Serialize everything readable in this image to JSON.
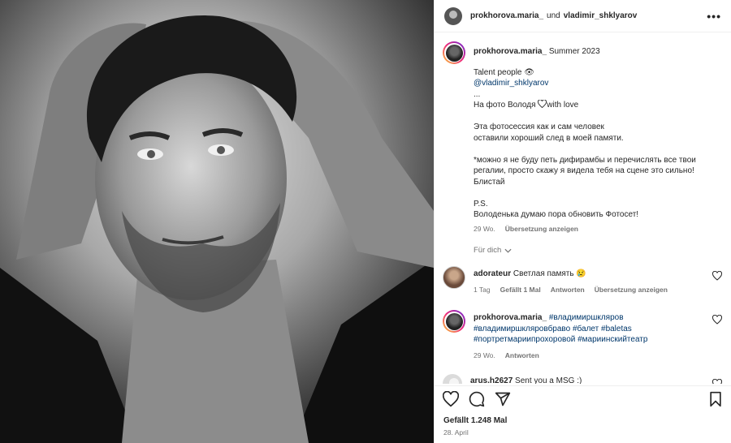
{
  "header": {
    "user1": "prokhorova.maria_",
    "und": "und",
    "user2": "vladimir_shklyarov",
    "more_icon": "more-horizontal-icon"
  },
  "caption": {
    "username": "prokhorova.maria_",
    "title": "Summer 2023",
    "lines": [
      "Talent people 👁",
      "@vladimir_shklyarov",
      "...",
      "На фото Володя ",
      "",
      "Эта фотосессия как и сам человек",
      "оставили хороший след в моей памяти.",
      "",
      "*можно я не буду петь дифирамбы и перечислять все твои",
      "регалии, просто скажу я видела тебя на сцене это сильно!",
      "Блистай",
      "",
      "P.S.",
      "Володенька думаю пора обновить Фотосет!"
    ],
    "heart_suffix": "with love",
    "time": "29 Wo.",
    "translate": "Übersetzung anzeigen"
  },
  "fuer_dich": "Für dich",
  "comments": [
    {
      "username": "adorateur",
      "text": "Светлая память 😢",
      "time": "1 Tag",
      "likes": "Gefällt 1 Mal",
      "reply": "Antworten",
      "translate": "Übersetzung anzeigen"
    },
    {
      "username": "prokhorova.maria_",
      "text": "#владимиршкляров",
      "text2": "#владимиршкляровбраво #балет #baletas",
      "text3": "#портретмариипрохоровой #мариинскийтеатр",
      "time": "29 Wo.",
      "reply": "Antworten"
    },
    {
      "username": "arus.h2627",
      "text": "Sent you a MSG :)"
    }
  ],
  "footer": {
    "likes": "Gefällt 1.248 Mal",
    "date": "28. April"
  },
  "colors": {
    "link": "#00376b",
    "meta": "#737373",
    "text": "#262626"
  }
}
